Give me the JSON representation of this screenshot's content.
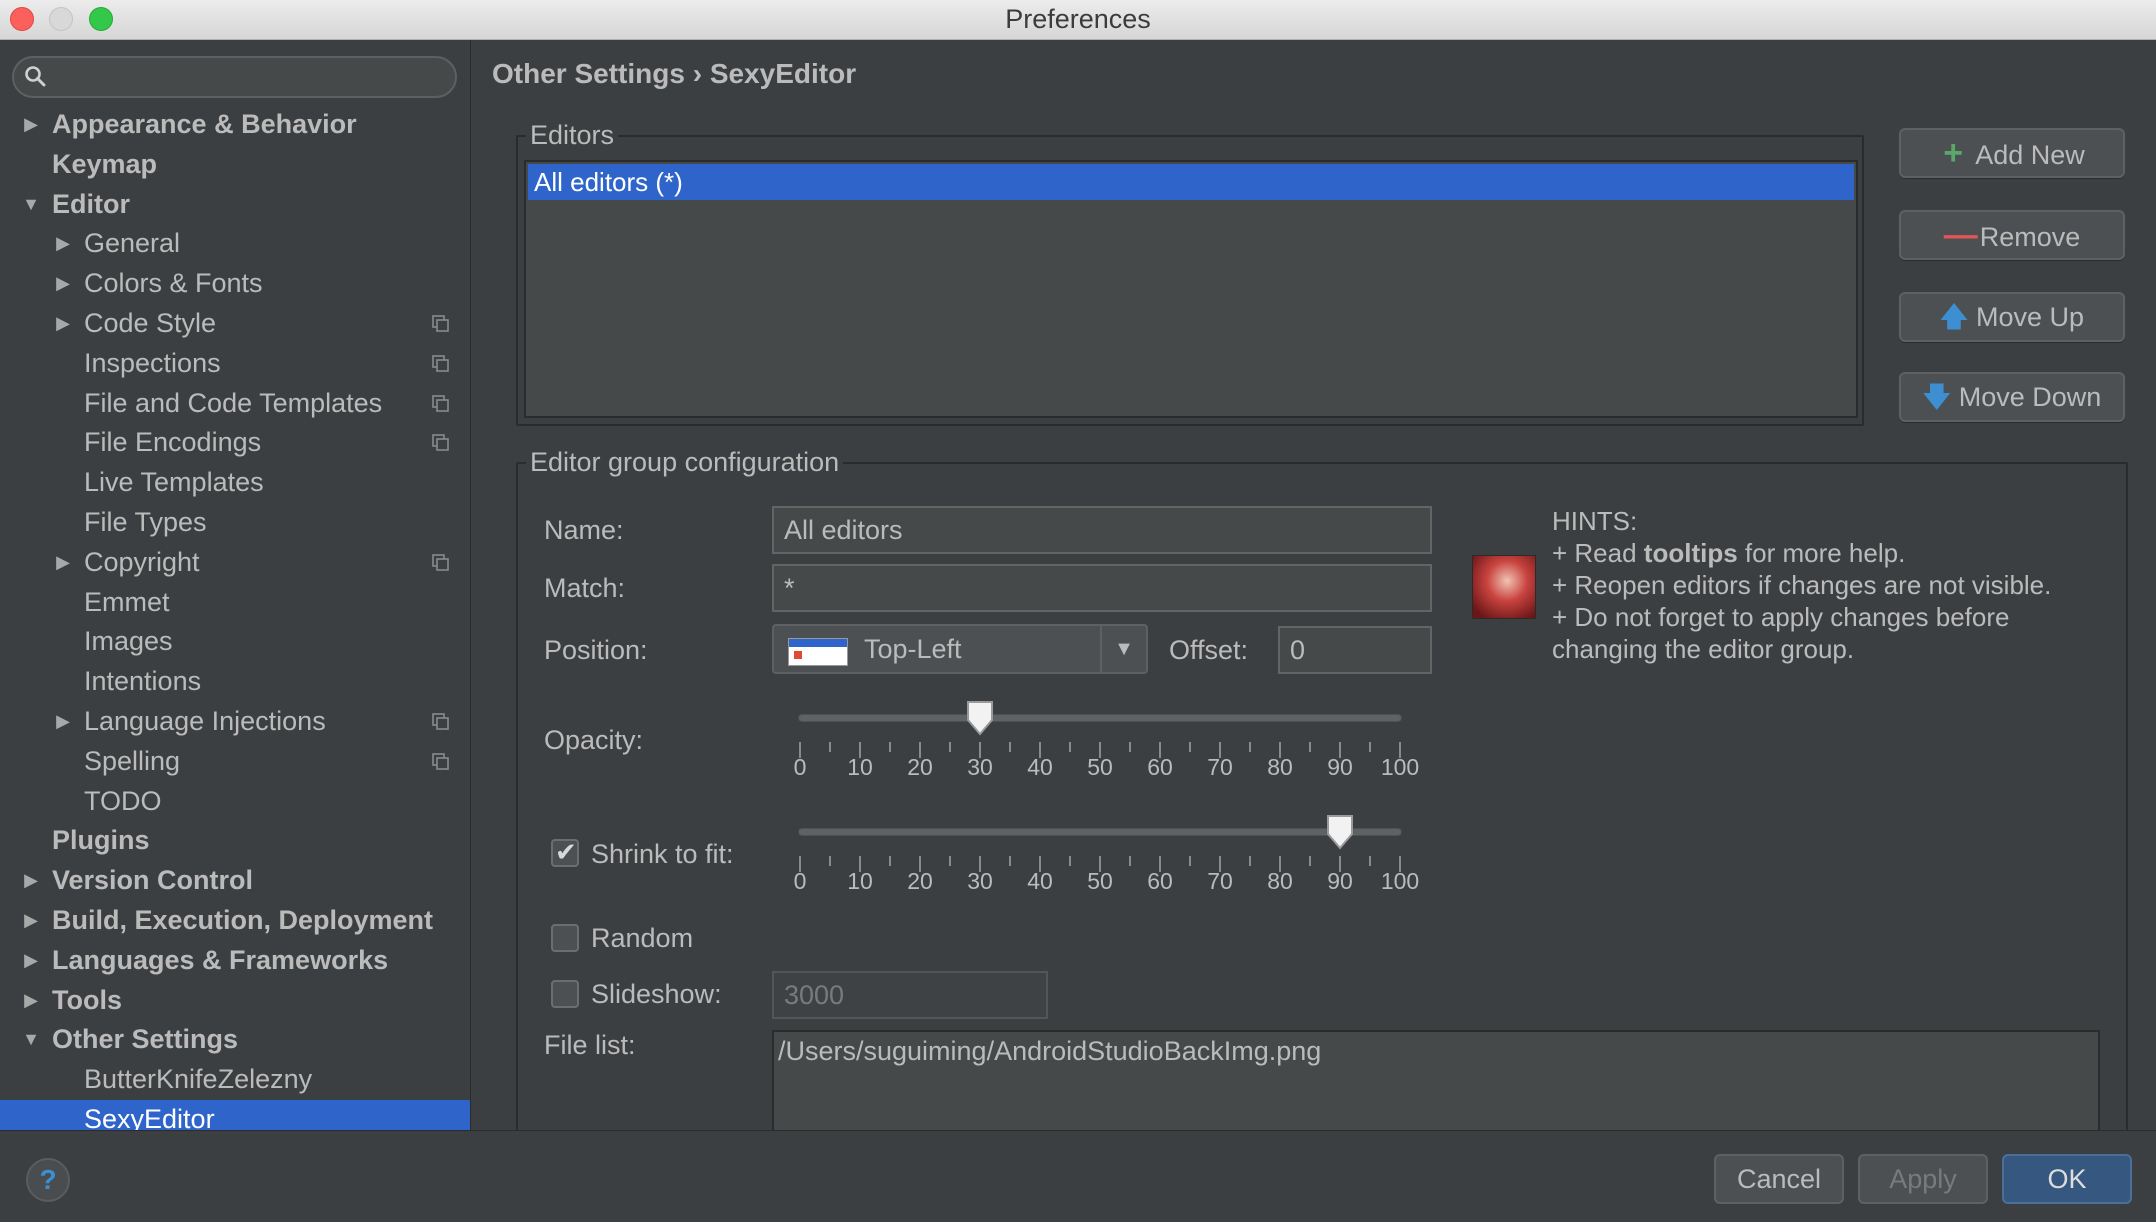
{
  "window": {
    "title": "Preferences"
  },
  "search": {
    "placeholder": "",
    "value": ""
  },
  "sidebar": {
    "items": [
      {
        "label": "Appearance & Behavior",
        "level": 0,
        "arrow": "▶",
        "bold": true
      },
      {
        "label": "Keymap",
        "level": 0,
        "arrow": "",
        "bold": true
      },
      {
        "label": "Editor",
        "level": 0,
        "arrow": "▼",
        "bold": true
      },
      {
        "label": "General",
        "level": 1,
        "arrow": "▶"
      },
      {
        "label": "Colors & Fonts",
        "level": 1,
        "arrow": "▶"
      },
      {
        "label": "Code Style",
        "level": 1,
        "arrow": "▶",
        "copy": true
      },
      {
        "label": "Inspections",
        "level": 1,
        "arrow": "",
        "copy": true
      },
      {
        "label": "File and Code Templates",
        "level": 1,
        "arrow": "",
        "copy": true
      },
      {
        "label": "File Encodings",
        "level": 1,
        "arrow": "",
        "copy": true
      },
      {
        "label": "Live Templates",
        "level": 1,
        "arrow": ""
      },
      {
        "label": "File Types",
        "level": 1,
        "arrow": ""
      },
      {
        "label": "Copyright",
        "level": 1,
        "arrow": "▶",
        "copy": true
      },
      {
        "label": "Emmet",
        "level": 1,
        "arrow": ""
      },
      {
        "label": "Images",
        "level": 1,
        "arrow": ""
      },
      {
        "label": "Intentions",
        "level": 1,
        "arrow": ""
      },
      {
        "label": "Language Injections",
        "level": 1,
        "arrow": "▶",
        "copy": true
      },
      {
        "label": "Spelling",
        "level": 1,
        "arrow": "",
        "copy": true
      },
      {
        "label": "TODO",
        "level": 1,
        "arrow": ""
      },
      {
        "label": "Plugins",
        "level": 0,
        "arrow": "",
        "bold": true
      },
      {
        "label": "Version Control",
        "level": 0,
        "arrow": "▶",
        "bold": true
      },
      {
        "label": "Build, Execution, Deployment",
        "level": 0,
        "arrow": "▶",
        "bold": true
      },
      {
        "label": "Languages & Frameworks",
        "level": 0,
        "arrow": "▶",
        "bold": true
      },
      {
        "label": "Tools",
        "level": 0,
        "arrow": "▶",
        "bold": true
      },
      {
        "label": "Other Settings",
        "level": 0,
        "arrow": "▼",
        "bold": true
      },
      {
        "label": "ButterKnifeZelezny",
        "level": 1,
        "arrow": ""
      },
      {
        "label": "SexyEditor",
        "level": 1,
        "arrow": "",
        "selected": true
      }
    ]
  },
  "breadcrumb": {
    "parent": "Other Settings",
    "separator": "›",
    "current": "SexyEditor"
  },
  "editors": {
    "legend": "Editors",
    "items": [
      "All editors (*)"
    ],
    "selected_index": 0,
    "buttons": {
      "add": "Add New",
      "remove": "Remove",
      "move_up": "Move Up",
      "move_down": "Move Down"
    }
  },
  "group_config": {
    "legend": "Editor group configuration",
    "name_label": "Name:",
    "name_value": "All editors",
    "match_label": "Match:",
    "match_value": "*",
    "position_label": "Position:",
    "position_value": "Top-Left",
    "offset_label": "Offset:",
    "offset_value": "0",
    "opacity_label": "Opacity:",
    "opacity_value": 30,
    "shrink_label": "Shrink to fit:",
    "shrink_checked": true,
    "shrink_value": 90,
    "slider_ticks": [
      "0",
      "10",
      "20",
      "30",
      "40",
      "50",
      "60",
      "70",
      "80",
      "90",
      "100"
    ],
    "random_label": "Random",
    "random_checked": false,
    "slideshow_label": "Slideshow:",
    "slideshow_checked": false,
    "slideshow_value": "3000",
    "file_list_label": "File list:",
    "file_list": [
      "/Users/suguiming/AndroidStudioBackImg.png"
    ]
  },
  "hints": {
    "title": "HINTS:",
    "line1_prefix": "+ Read ",
    "line1_bold": "tooltips",
    "line1_suffix": " for more help.",
    "line2": "+ Reopen editors if changes are not visible.",
    "line3": "+ Do not forget to apply changes before",
    "line4": "changing the editor group."
  },
  "footer": {
    "help": "?",
    "cancel": "Cancel",
    "apply": "Apply",
    "ok": "OK"
  },
  "colors": {
    "selection": "#2f65ca",
    "background": "#3c3f41",
    "text": "#bbbbbb",
    "add_icon": "#59a869",
    "remove_icon": "#e05555",
    "move_icon": "#3d8fd1"
  },
  "icons": {
    "add": "plus-icon",
    "remove": "minus-icon",
    "move_up": "arrow-up-icon",
    "move_down": "arrow-down-icon",
    "search": "search-icon"
  }
}
